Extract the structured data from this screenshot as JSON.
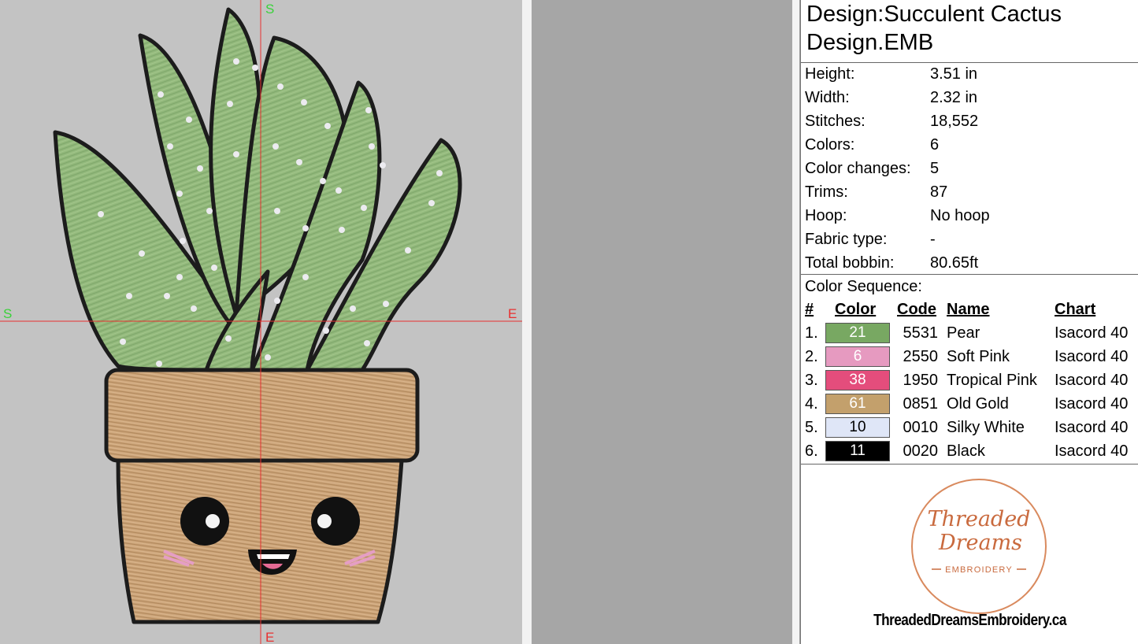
{
  "preview": {
    "axis_labels": {
      "top": "S",
      "left": "S",
      "right": "E",
      "bottom": "E"
    }
  },
  "info": {
    "title_line1": "Design:Succulent Cactus",
    "title_line2": "Design.EMB",
    "fields": [
      {
        "label": "Height:",
        "value": "3.51 in"
      },
      {
        "label": "Width:",
        "value": "2.32 in"
      },
      {
        "label": "Stitches:",
        "value": "18,552"
      },
      {
        "label": "Colors:",
        "value": "6"
      },
      {
        "label": "Color changes:",
        "value": "5"
      },
      {
        "label": "Trims:",
        "value": "87"
      },
      {
        "label": "Hoop:",
        "value": "No hoop"
      },
      {
        "label": "Fabric type:",
        "value": "-"
      },
      {
        "label": "Total bobbin:",
        "value": "80.65ft"
      }
    ],
    "color_sequence_label": "Color Sequence:",
    "headers": {
      "num": "#",
      "color": "Color",
      "code": "Code",
      "name": "Name",
      "chart": "Chart"
    },
    "colors": [
      {
        "num": "1.",
        "swatch": "21",
        "hex": "#78a862",
        "text_color": "#ffffff",
        "code": "5531",
        "name": "Pear",
        "chart": "Isacord 40"
      },
      {
        "num": "2.",
        "swatch": "6",
        "hex": "#e69ac0",
        "text_color": "#ffffff",
        "code": "2550",
        "name": "Soft Pink",
        "chart": "Isacord 40"
      },
      {
        "num": "3.",
        "swatch": "38",
        "hex": "#e44d7c",
        "text_color": "#ffffff",
        "code": "1950",
        "name": "Tropical Pink",
        "chart": "Isacord 40"
      },
      {
        "num": "4.",
        "swatch": "61",
        "hex": "#c3a06c",
        "text_color": "#ffffff",
        "code": "0851",
        "name": "Old Gold",
        "chart": "Isacord 40"
      },
      {
        "num": "5.",
        "swatch": "10",
        "hex": "#dfe6f7",
        "text_color": "#000000",
        "code": "0010",
        "name": "Silky White",
        "chart": "Isacord 40"
      },
      {
        "num": "6.",
        "swatch": "11",
        "hex": "#000000",
        "text_color": "#ffffff",
        "code": "0020",
        "name": "Black",
        "chart": "Isacord 40"
      }
    ],
    "logo": {
      "line1": "Threaded",
      "line2": "Dreams",
      "line3": "EMBROIDERY"
    },
    "website": "ThreadedDreamsEmbroidery.ca"
  }
}
